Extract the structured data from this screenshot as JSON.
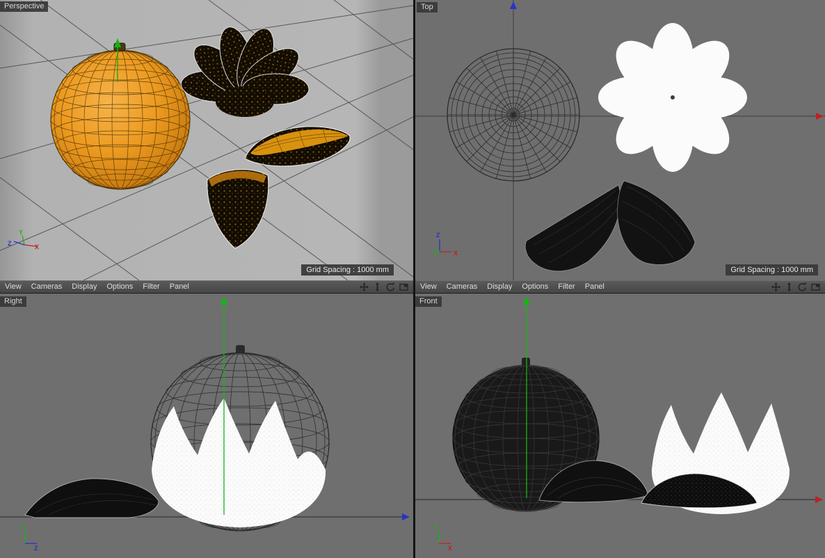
{
  "menus": {
    "items": [
      "View",
      "Cameras",
      "Display",
      "Options",
      "Filter",
      "Panel"
    ],
    "icons": [
      "pan-icon",
      "dolly-icon",
      "rotate-icon",
      "maximize-icon"
    ]
  },
  "viewports": {
    "perspective": {
      "label": "Perspective",
      "grid_spacing": "Grid Spacing : 1000 mm",
      "axis_labels": {
        "x": "X",
        "y": "Y",
        "z": "Z"
      }
    },
    "top": {
      "label": "Top",
      "grid_spacing": "Grid Spacing : 1000 mm",
      "axis_labels": {
        "x": "X",
        "y": "Y",
        "z": "Z"
      }
    },
    "right": {
      "label": "Right",
      "axis_labels": {
        "y": "Y",
        "z": "Z"
      }
    },
    "front": {
      "label": "Front",
      "axis_labels": {
        "y": "Y",
        "x": "X"
      }
    }
  },
  "scene": {
    "objects": [
      "orange-sphere",
      "peeled-rind-flower",
      "orange-segment-right",
      "orange-segment-bottom",
      "white-peel-crown"
    ]
  },
  "colors": {
    "axis_x": "#c02020",
    "axis_y": "#16b416",
    "axis_z": "#2535c8",
    "orange": "#e8921c",
    "menu_bar": "#4a4a4a",
    "viewport_dark": "#6f6f6f",
    "viewport_light": "#b2b2b2",
    "chip_bg": "#383838",
    "white_object": "#fbfbfb",
    "dark_object": "#120d03"
  }
}
